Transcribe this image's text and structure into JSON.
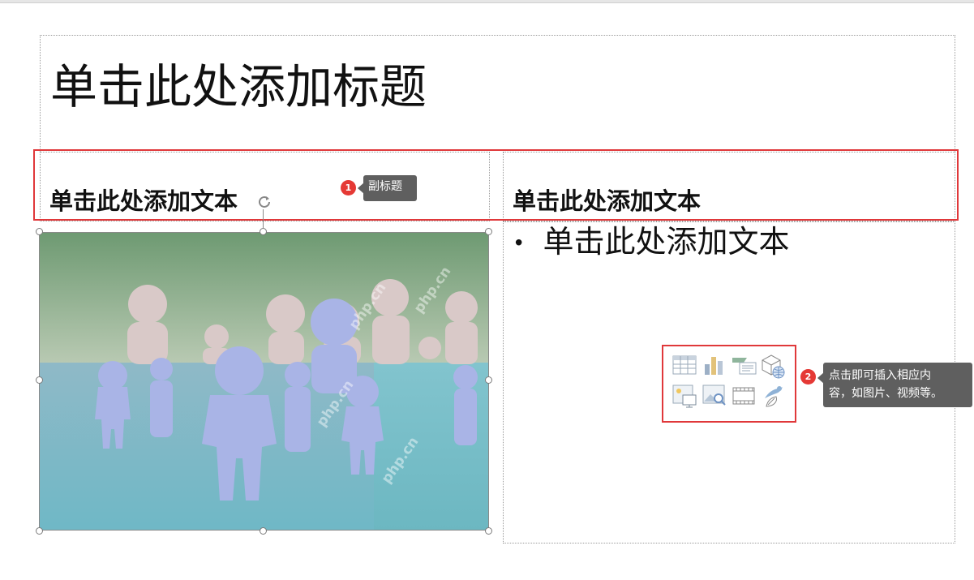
{
  "slide": {
    "title_placeholder": "单击此处添加标题",
    "left_header": "单击此处添加文本",
    "right_header": "单击此处添加文本",
    "right_bullet": "单击此处添加文本",
    "bullet_char": "•"
  },
  "annotations": {
    "one": {
      "number": "1",
      "text": "副标题"
    },
    "two": {
      "number": "2",
      "line1": "点击即可插入相应内",
      "line2": "容，如图片、视频等。"
    }
  },
  "watermark": "php.cn",
  "content_icons": [
    {
      "name": "table-icon"
    },
    {
      "name": "chart-icon"
    },
    {
      "name": "smartart-icon"
    },
    {
      "name": "3d-model-icon"
    },
    {
      "name": "picture-icon"
    },
    {
      "name": "online-picture-icon"
    },
    {
      "name": "video-icon"
    },
    {
      "name": "icons-icon"
    }
  ],
  "colors": {
    "highlight_red": "#e0383a",
    "badge_red": "#e53935",
    "callout_bg": "#5f5f5f",
    "icon_blue": "#7a9ccc"
  }
}
